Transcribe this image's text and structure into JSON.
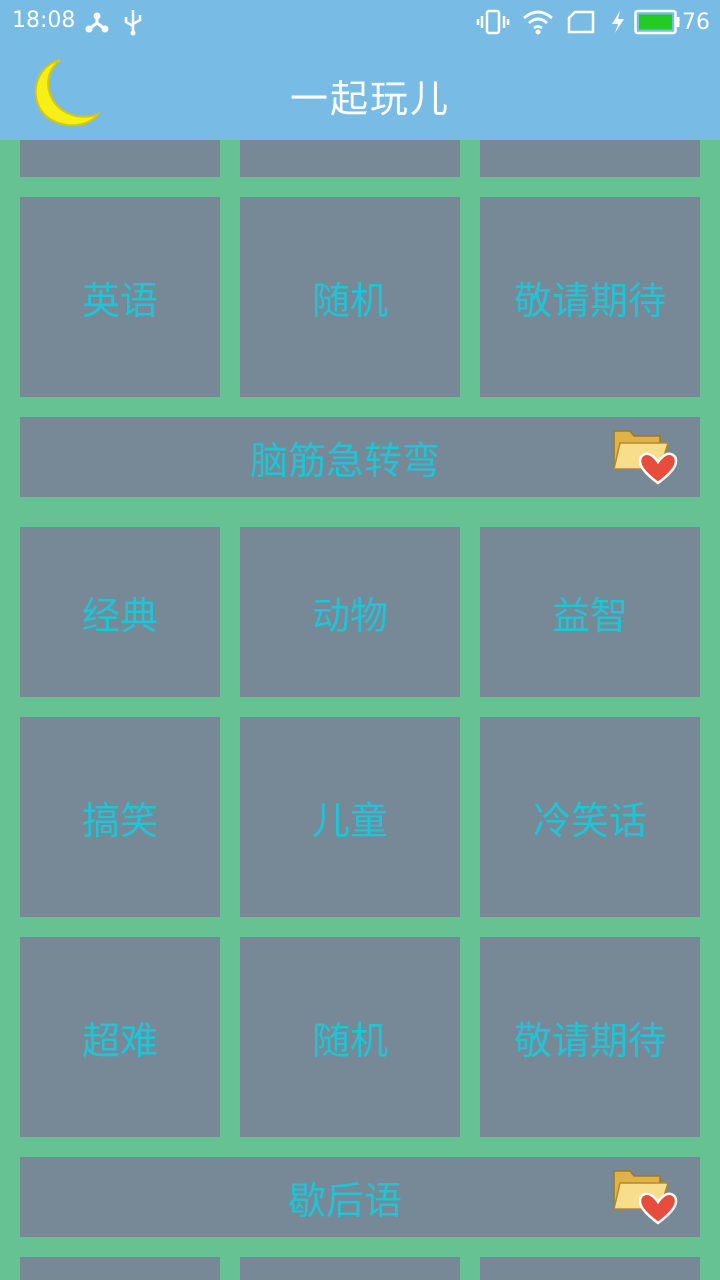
{
  "status_bar": {
    "time": "18:08",
    "battery": "76",
    "icons": [
      "share-icon",
      "usb-icon",
      "vibrate-icon",
      "wifi-icon",
      "sim-icon",
      "charging-icon",
      "battery-icon"
    ]
  },
  "app_bar": {
    "title": "一起玩儿",
    "logo": "moon-icon"
  },
  "sections": {
    "english": {
      "row": [
        "英语",
        "随机",
        "敬请期待"
      ]
    },
    "brain_teaser": {
      "title": "脑筋急转弯",
      "rows": [
        [
          "经典",
          "动物",
          "益智"
        ],
        [
          "搞笑",
          "儿童",
          "冷笑话"
        ],
        [
          "超难",
          "随机",
          "敬请期待"
        ]
      ]
    },
    "xiehouyu": {
      "title": "歇后语"
    }
  },
  "colors": {
    "background": "#66c293",
    "bar": "#78bce6",
    "tile": "#778897",
    "tile_text": "#1fc4d6",
    "battery": "#22cc22"
  }
}
